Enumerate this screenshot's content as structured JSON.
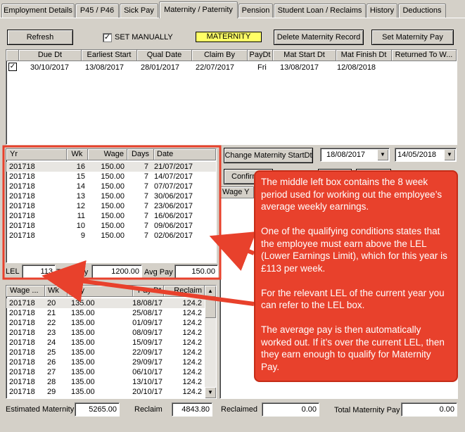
{
  "tabs": [
    {
      "label": "Employment Details"
    },
    {
      "label": "P45 / P46"
    },
    {
      "label": "Sick Pay"
    },
    {
      "label": "Maternity / Paternity"
    },
    {
      "label": "Pension"
    },
    {
      "label": "Student Loan / Reclaims"
    },
    {
      "label": "History"
    },
    {
      "label": "Deductions"
    }
  ],
  "toolbar": {
    "refresh_label": "Refresh",
    "set_manually_label": "SET MANUALLY",
    "set_manually_checked": "✓",
    "maternity_badge": "MATERNITY",
    "delete_label": "Delete Maternity Record",
    "set_pay_label": "Set Maternity Pay"
  },
  "records": {
    "columns": [
      "Due Dt",
      "Earliest Start",
      "Qual Date",
      "Claim By",
      "PayDt",
      "Mat Start Dt",
      "Mat Finish Dt",
      "Returned To W..."
    ],
    "rows": [
      {
        "check": "✓",
        "due": "30/10/2017",
        "earliest": "13/08/2017",
        "qual": "28/01/2017",
        "claim": "22/07/2017",
        "paydt": "Fri",
        "start": "13/08/2017",
        "finish": "12/08/2018",
        "returned": ""
      }
    ]
  },
  "change_start_label": "Change Maternity StartDt",
  "start_combo": "18/08/2017",
  "finish_combo": "14/05/2018",
  "confirm_label": "Confirm",
  "wage_y_header": "Wage Y",
  "earnings": {
    "columns": [
      "Yr",
      "Wk",
      "Wage",
      "Days",
      "Date"
    ],
    "rows": [
      [
        "201718",
        "16",
        "150.00",
        "7",
        "21/07/2017"
      ],
      [
        "201718",
        "15",
        "150.00",
        "7",
        "14/07/2017"
      ],
      [
        "201718",
        "14",
        "150.00",
        "7",
        "07/07/2017"
      ],
      [
        "201718",
        "13",
        "150.00",
        "7",
        "30/06/2017"
      ],
      [
        "201718",
        "12",
        "150.00",
        "7",
        "23/06/2017"
      ],
      [
        "201718",
        "11",
        "150.00",
        "7",
        "16/06/2017"
      ],
      [
        "201718",
        "10",
        "150.00",
        "7",
        "09/06/2017"
      ],
      [
        "201718",
        "9",
        "150.00",
        "7",
        "02/06/2017"
      ]
    ]
  },
  "lel_label": "LEL",
  "lel_value": "113",
  "total_pay_label": "Total Pay",
  "total_pay_value": "1200.00",
  "avg_pay_label": "Avg Pay",
  "avg_pay_value": "150.00",
  "payments": {
    "columns": [
      "Wage ...",
      "Wk",
      "Pay",
      "Pay Dt",
      "Reclaim"
    ],
    "rows": [
      [
        "201718",
        "20",
        "135.00",
        "18/08/17",
        "124.2"
      ],
      [
        "201718",
        "21",
        "135.00",
        "25/08/17",
        "124.2"
      ],
      [
        "201718",
        "22",
        "135.00",
        "01/09/17",
        "124.2"
      ],
      [
        "201718",
        "23",
        "135.00",
        "08/09/17",
        "124.2"
      ],
      [
        "201718",
        "24",
        "135.00",
        "15/09/17",
        "124.2"
      ],
      [
        "201718",
        "25",
        "135.00",
        "22/09/17",
        "124.2"
      ],
      [
        "201718",
        "26",
        "135.00",
        "29/09/17",
        "124.2"
      ],
      [
        "201718",
        "27",
        "135.00",
        "06/10/17",
        "124.2"
      ],
      [
        "201718",
        "28",
        "135.00",
        "13/10/17",
        "124.2"
      ],
      [
        "201718",
        "29",
        "135.00",
        "20/10/17",
        "124.2"
      ]
    ]
  },
  "footer": {
    "estimated_label": "Estimated Maternity",
    "estimated_value": "5265.00",
    "reclaim_label": "Reclaim",
    "reclaim_value": "4843.80",
    "reclaimed_label": "Reclaimed",
    "reclaimed_value": "0.00",
    "total_label": "Total Maternity Pay",
    "total_value": "0.00"
  },
  "callout": {
    "p1": "The middle left box contains the 8 week period used for working out the employee’s average weekly earnings.",
    "p2": "One of the qualifying conditions states that the employee must earn above the LEL (Lower Earnings Limit), which for this year is £113 per week.",
    "p3": "For the relevant LEL of the current year you can refer to the LEL box.",
    "p4": "The average pay is then automatically worked out. If it’s over the current LEL, then they earn enough to qualify for Maternity Pay."
  },
  "colors": {
    "window": "#d4d0c8",
    "badge": "#ffff66",
    "callout": "#e8412c",
    "annotation_red": "#e8412c"
  }
}
